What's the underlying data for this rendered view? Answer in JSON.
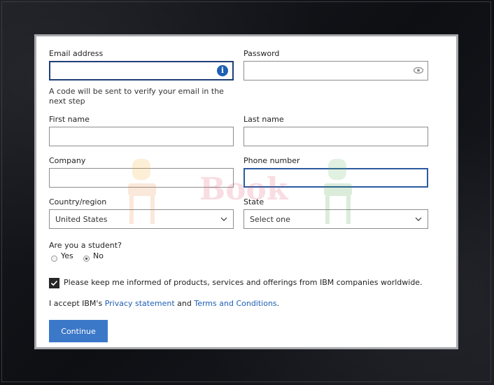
{
  "form": {
    "email": {
      "label": "Email address",
      "value": ""
    },
    "email_hint": "A code will be sent to verify your email in the next step",
    "password": {
      "label": "Password",
      "value": ""
    },
    "first_name": {
      "label": "First name",
      "value": ""
    },
    "last_name": {
      "label": "Last name",
      "value": ""
    },
    "company": {
      "label": "Company",
      "value": ""
    },
    "phone": {
      "label": "Phone number",
      "value": ""
    },
    "country": {
      "label": "Country/region",
      "value": "United States"
    },
    "state": {
      "label": "State",
      "value": "Select one"
    },
    "student": {
      "question": "Are you a student?",
      "options": [
        "Yes",
        "No"
      ],
      "selected": "No"
    },
    "consent": {
      "checked": true,
      "label": "Please keep me informed of products, services and offerings from IBM companies worldwide."
    },
    "terms": {
      "prefix": "I accept IBM's",
      "privacy_link": "Privacy statement",
      "and": "and",
      "terms_link": "Terms and Conditions",
      "suffix": "."
    },
    "submit_label": "Continue"
  },
  "watermark": {
    "text": "Book"
  },
  "icons": {
    "email_info": "info-icon",
    "password_toggle": "eye-icon",
    "country_dropdown": "chevron-down-icon",
    "state_dropdown": "chevron-down-icon",
    "consent_check": "checkmark-icon"
  },
  "colors": {
    "accent": "#3c78c8",
    "link": "#1f5fb4",
    "focus_border": "#1f3f78"
  }
}
